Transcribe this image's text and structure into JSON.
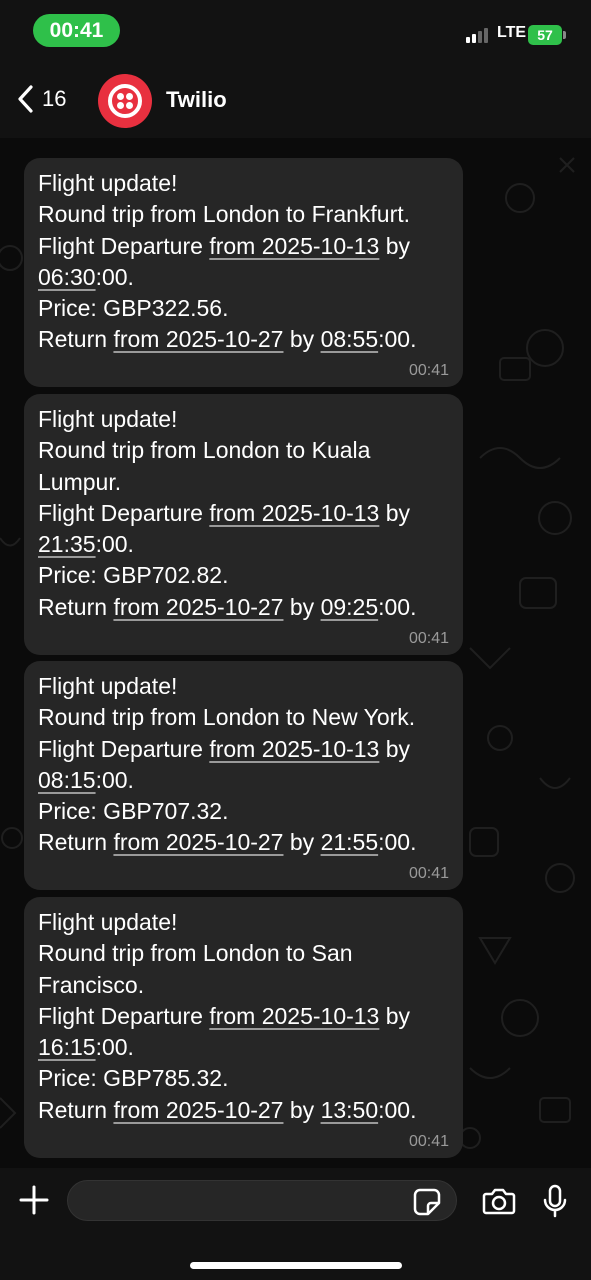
{
  "status_bar": {
    "time": "00:41",
    "network": "LTE",
    "battery": "57"
  },
  "header": {
    "back_count": "16",
    "contact_name": "Twilio"
  },
  "messages": [
    {
      "lines": [
        {
          "segments": [
            {
              "t": "Flight update!"
            }
          ]
        },
        {
          "segments": [
            {
              "t": "Round trip from London to Frankfurt."
            }
          ]
        },
        {
          "segments": [
            {
              "t": "Flight Departure "
            },
            {
              "t": "from 2025-10-13",
              "u": true
            },
            {
              "t": " by"
            }
          ]
        },
        {
          "segments": [
            {
              "t": "06:30",
              "u": true
            },
            {
              "t": ":00."
            }
          ]
        },
        {
          "segments": [
            {
              "t": "Price: GBP322.56."
            }
          ]
        },
        {
          "segments": [
            {
              "t": "Return "
            },
            {
              "t": "from 2025-10-27",
              "u": true
            },
            {
              "t": " by "
            },
            {
              "t": "08:55",
              "u": true
            },
            {
              "t": ":00."
            }
          ]
        }
      ],
      "time": "00:41"
    },
    {
      "lines": [
        {
          "segments": [
            {
              "t": "Flight update!"
            }
          ]
        },
        {
          "segments": [
            {
              "t": "Round trip from London to Kuala"
            }
          ]
        },
        {
          "segments": [
            {
              "t": "Lumpur."
            }
          ]
        },
        {
          "segments": [
            {
              "t": "Flight Departure "
            },
            {
              "t": "from 2025-10-13",
              "u": true
            },
            {
              "t": " by"
            }
          ]
        },
        {
          "segments": [
            {
              "t": "21:35",
              "u": true
            },
            {
              "t": ":00."
            }
          ]
        },
        {
          "segments": [
            {
              "t": "Price: GBP702.82."
            }
          ]
        },
        {
          "segments": [
            {
              "t": "Return "
            },
            {
              "t": "from 2025-10-27",
              "u": true
            },
            {
              "t": " by "
            },
            {
              "t": "09:25",
              "u": true
            },
            {
              "t": ":00."
            }
          ]
        }
      ],
      "time": "00:41"
    },
    {
      "lines": [
        {
          "segments": [
            {
              "t": "Flight update!"
            }
          ]
        },
        {
          "segments": [
            {
              "t": "Round trip from London to New York."
            }
          ]
        },
        {
          "segments": [
            {
              "t": "Flight Departure "
            },
            {
              "t": "from 2025-10-13",
              "u": true
            },
            {
              "t": " by"
            }
          ]
        },
        {
          "segments": [
            {
              "t": "08:15",
              "u": true
            },
            {
              "t": ":00."
            }
          ]
        },
        {
          "segments": [
            {
              "t": "Price: GBP707.32."
            }
          ]
        },
        {
          "segments": [
            {
              "t": "Return "
            },
            {
              "t": "from 2025-10-27",
              "u": true
            },
            {
              "t": " by "
            },
            {
              "t": "21:55",
              "u": true
            },
            {
              "t": ":00."
            }
          ]
        }
      ],
      "time": "00:41"
    },
    {
      "lines": [
        {
          "segments": [
            {
              "t": "Flight update!"
            }
          ]
        },
        {
          "segments": [
            {
              "t": "Round trip from London to San"
            }
          ]
        },
        {
          "segments": [
            {
              "t": "Francisco."
            }
          ]
        },
        {
          "segments": [
            {
              "t": "Flight Departure "
            },
            {
              "t": "from 2025-10-13",
              "u": true
            },
            {
              "t": " by"
            }
          ]
        },
        {
          "segments": [
            {
              "t": "16:15",
              "u": true
            },
            {
              "t": ":00."
            }
          ]
        },
        {
          "segments": [
            {
              "t": "Price: GBP785.32."
            }
          ]
        },
        {
          "segments": [
            {
              "t": "Return "
            },
            {
              "t": "from 2025-10-27",
              "u": true
            },
            {
              "t": " by "
            },
            {
              "t": "13:50",
              "u": true
            },
            {
              "t": ":00."
            }
          ]
        }
      ],
      "time": "00:41"
    }
  ],
  "composer": {
    "input_value": ""
  },
  "icons": {
    "back": "chevron-left-icon",
    "add": "plus-icon",
    "sticker": "sticker-icon",
    "camera": "camera-icon",
    "mic": "microphone-icon"
  },
  "colors": {
    "time_pill": "#2fc04a",
    "battery": "#2fc04a",
    "avatar": "#e8303f",
    "bubble": "#262626",
    "background": "#0b0b0b"
  }
}
